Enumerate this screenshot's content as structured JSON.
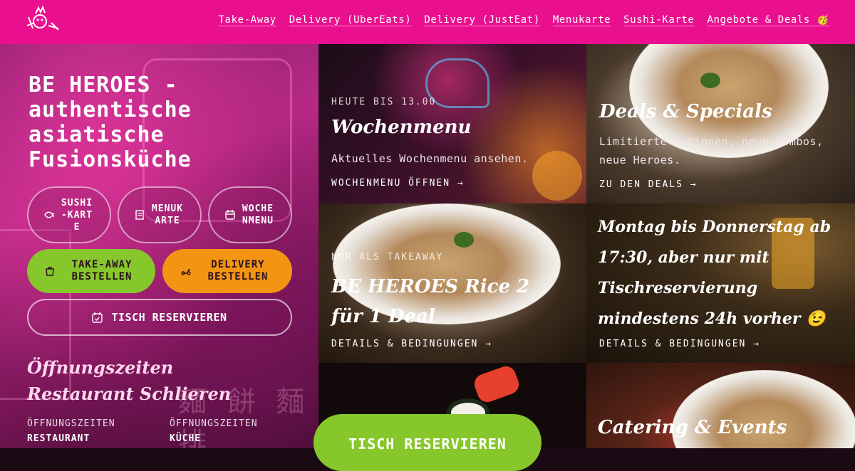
{
  "header": {
    "nav": [
      "Take-Away",
      "Delivery (UberEats)",
      "Delivery (JustEat)",
      "Menukarte",
      "Sushi-Karte",
      "Angebote & Deals 🥳"
    ],
    "brand_color": "#ea0f8f"
  },
  "hero": {
    "title": "BE HEROES - authentische asiatische Fusionsküche",
    "buttons": {
      "sushi": "SUSHI-KARTE",
      "menu": "MENUKARTE",
      "week": "WOCHENMENU",
      "takeaway": "TAKE-AWAY BESTELLEN",
      "delivery": "DELIVERY BESTELLEN",
      "reserve": "TISCH RESERVIEREN"
    },
    "hours_title": "Öffnungszeiten Restaurant Schlieren",
    "hours": [
      {
        "label": "ÖFFNUNGSZEITEN",
        "value": "RESTAURANT"
      },
      {
        "label": "ÖFFNUNGSZEITEN",
        "value": "KÜCHE"
      }
    ]
  },
  "tiles": {
    "weekmenu": {
      "eyebrow": "HEUTE BIS 13.00",
      "title": "Wochenmenu",
      "desc": "Aktuelles Wochenmenu ansehen.",
      "link": "WOCHENMENU ÖFFNEN →"
    },
    "deals": {
      "title": "Deals & Specials",
      "desc": "Limitierte Aktionen, neue Kombos, neue Heroes.",
      "link": "ZU DEN DEALS →"
    },
    "rice": {
      "eyebrow": "NUR ALS TAKEAWAY",
      "title": "BE HEROES Rice 2 für 1 Deal",
      "link": "DETAILS & BEDINGUNGEN →"
    },
    "monday": {
      "title": "Montag bis Donnerstag ab 17:30, aber nur mit Tischreservierung mindestens 24h vorher 😉",
      "link": "DETAILS & BEDINGUNGEN →"
    },
    "sushi_cta": "TISCH RESERVIEREN",
    "catering": {
      "title": "Catering & Events"
    }
  },
  "colors": {
    "green": "#86c72b",
    "orange": "#f39512"
  }
}
